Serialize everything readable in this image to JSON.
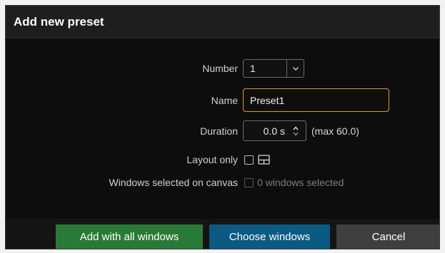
{
  "dialog": {
    "title": "Add new preset"
  },
  "form": {
    "number": {
      "label": "Number",
      "value": "1"
    },
    "name": {
      "label": "Name",
      "value": "Preset1"
    },
    "duration": {
      "label": "Duration",
      "value": "0.0 s",
      "hint": "(max 60.0)"
    },
    "layout_only": {
      "label": "Layout only",
      "checked": false,
      "icon": "layout-icon"
    },
    "windows_selected": {
      "label": "Windows selected on canvas",
      "checked": false,
      "disabled": true,
      "hint": "0 windows selected"
    }
  },
  "buttons": {
    "add_all": "Add with all windows",
    "choose": "Choose windows",
    "cancel": "Cancel"
  },
  "colors": {
    "accent_focus": "#e09a27",
    "add_button": "#2a7a37",
    "choose_button": "#0b5a82",
    "cancel_button": "#3f3f3f"
  }
}
